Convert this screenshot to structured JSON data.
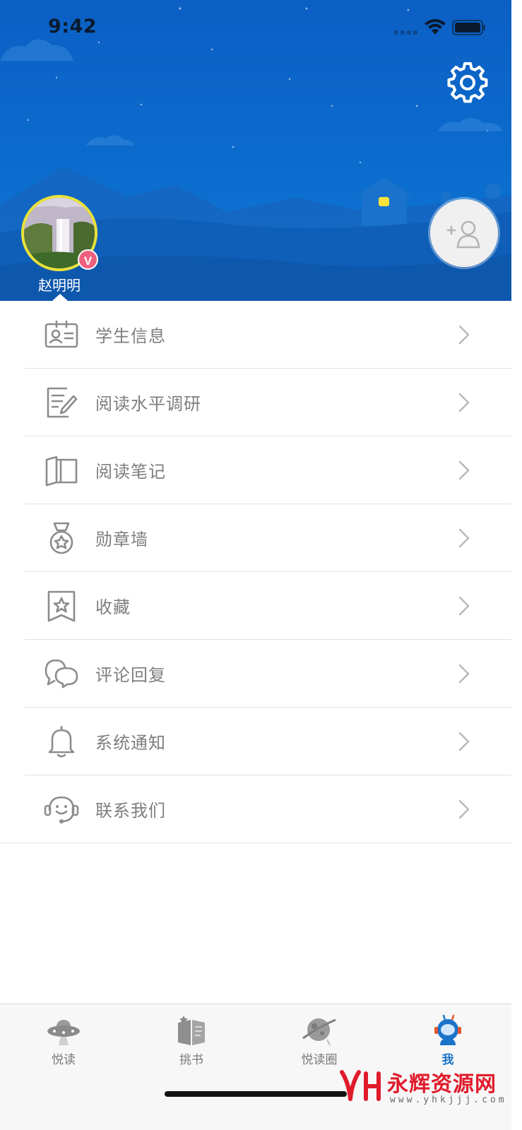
{
  "status_bar": {
    "time": "9:42"
  },
  "profile": {
    "name": "赵明明",
    "badge": "V"
  },
  "menu": [
    {
      "label": "学生信息",
      "icon": "id-card-icon"
    },
    {
      "label": "阅读水平调研",
      "icon": "survey-edit-icon"
    },
    {
      "label": "阅读笔记",
      "icon": "open-book-icon"
    },
    {
      "label": "勋章墙",
      "icon": "medal-icon"
    },
    {
      "label": "收藏",
      "icon": "bookmark-star-icon"
    },
    {
      "label": "评论回复",
      "icon": "chat-bubbles-icon"
    },
    {
      "label": "系统通知",
      "icon": "bell-icon"
    },
    {
      "label": "联系我们",
      "icon": "headset-support-icon"
    }
  ],
  "tabs": [
    {
      "label": "悦读",
      "icon": "ufo-icon",
      "active": false
    },
    {
      "label": "挑书",
      "icon": "book-stack-icon",
      "active": false
    },
    {
      "label": "悦读圈",
      "icon": "planet-icon",
      "active": false
    },
    {
      "label": "我",
      "icon": "astronaut-icon",
      "active": true
    }
  ],
  "watermark": {
    "title": "永辉资源网",
    "url": "www.yhkjjj.com"
  },
  "colors": {
    "header_blue": "#0b6ccd",
    "accent": "#1a73c9",
    "vip": "#f0607e",
    "avatar_ring": "#e8e23a",
    "watermark": "#e01b2b"
  }
}
